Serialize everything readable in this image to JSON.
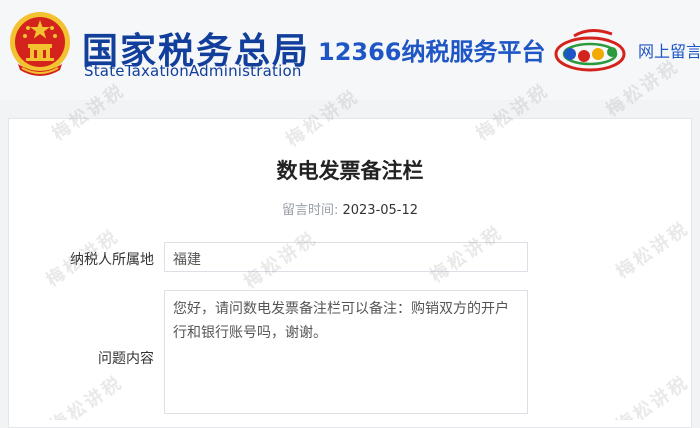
{
  "header": {
    "brand_cn": "国家税务总局",
    "brand_en": "StateTaxationAdministration",
    "platform": "12366纳税服务平台",
    "nav_link": "网上留言"
  },
  "message": {
    "title": "数电发票备注栏",
    "date_label": "留言时间:",
    "date_value": "2023-05-12",
    "region_label": "纳税人所属地",
    "region_value": "福建",
    "question_label": "问题内容",
    "question_text": "您好，请问数电发票备注栏可以备注：购销双方的开户行和银行账号吗，谢谢。"
  },
  "watermark": "梅松讲税",
  "colors": {
    "brand": "#123f9c",
    "accent": "#1f56c5",
    "emblem_red": "#d4231c",
    "emblem_gold": "#f2c230"
  },
  "icons": {
    "emblem": "national-emblem-icon",
    "logo": "12366-logo-icon"
  }
}
